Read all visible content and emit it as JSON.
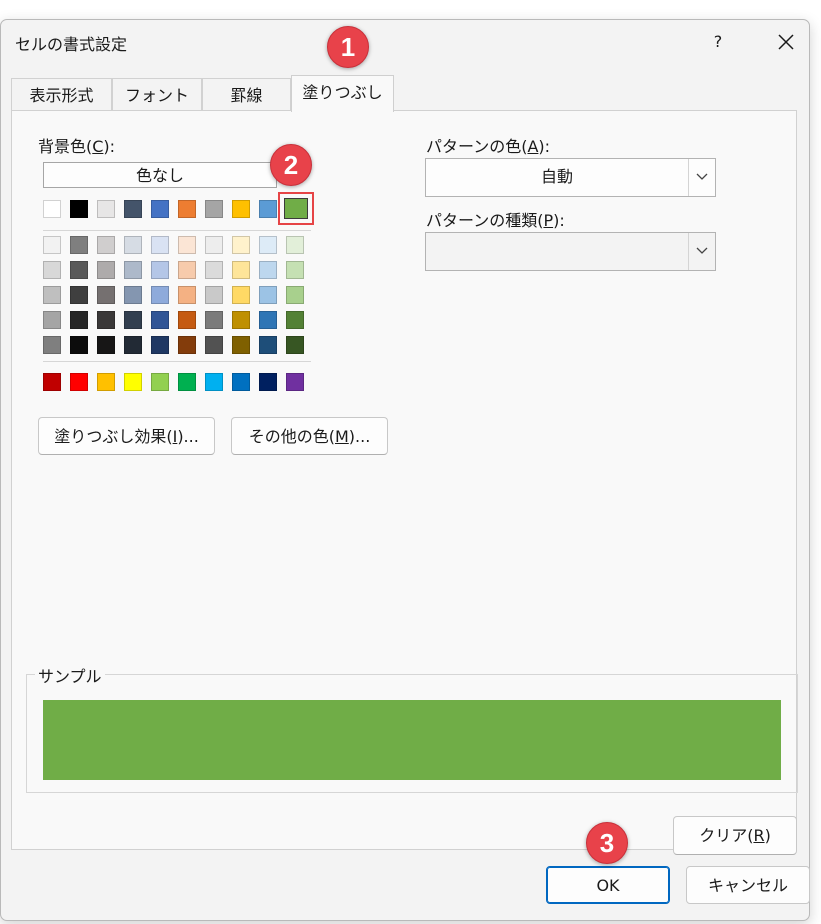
{
  "dialog": {
    "title": "セルの書式設定",
    "help_label": "?",
    "close_label": "✕"
  },
  "tabs": [
    {
      "label": "表示形式",
      "active": false
    },
    {
      "label": "フォント",
      "active": false
    },
    {
      "label": "罫線",
      "active": false
    },
    {
      "label": "塗りつぶし",
      "active": true
    }
  ],
  "fill": {
    "background_label_pre": "背景色(",
    "background_label_key": "C",
    "background_label_post": "):",
    "no_color_label": "色なし",
    "theme_row": [
      "#ffffff",
      "#000000",
      "#e7e6e6",
      "#44546a",
      "#4472c4",
      "#ed7d31",
      "#a5a5a5",
      "#ffc000",
      "#5b9bd5",
      "#70ad47"
    ],
    "tint_rows": [
      [
        "#f2f2f2",
        "#7f7f7f",
        "#d0cece",
        "#d6dce4",
        "#d9e2f3",
        "#fbe5d5",
        "#ededed",
        "#fff2cc",
        "#ddebf7",
        "#e2efd9"
      ],
      [
        "#d8d8d8",
        "#595959",
        "#aeabab",
        "#adb9ca",
        "#b4c6e7",
        "#f7cbac",
        "#dbdbdb",
        "#fee599",
        "#bdd7ee",
        "#c5e0b3"
      ],
      [
        "#bfbfbf",
        "#3f3f3f",
        "#757070",
        "#8496b0",
        "#8eaadb",
        "#f4b183",
        "#c9c9c9",
        "#ffd965",
        "#9cc3e5",
        "#a8d08d"
      ],
      [
        "#a5a5a5",
        "#262626",
        "#3a3838",
        "#323f4f",
        "#2f5496",
        "#c55a11",
        "#7b7b7b",
        "#bf9000",
        "#2e75b5",
        "#538135"
      ],
      [
        "#7f7f7f",
        "#0c0c0c",
        "#171616",
        "#222a35",
        "#1f3864",
        "#833c0b",
        "#525252",
        "#7f6000",
        "#1e4e79",
        "#375623"
      ]
    ],
    "standard_row": [
      "#c00000",
      "#ff0000",
      "#ffc000",
      "#ffff00",
      "#92d050",
      "#00b050",
      "#00b0f0",
      "#0070c0",
      "#002060",
      "#7030a0"
    ],
    "selected_color": "#70ad47",
    "fill_effects_pre": "塗りつぶし効果(",
    "fill_effects_key": "I",
    "fill_effects_post": ")...",
    "more_colors_pre": "その他の色(",
    "more_colors_key": "M",
    "more_colors_post": ")..."
  },
  "pattern": {
    "color_label_pre": "パターンの色(",
    "color_label_key": "A",
    "color_label_post": "):",
    "color_value": "自動",
    "style_label_pre": "パターンの種類(",
    "style_label_key": "P",
    "style_label_post": "):",
    "style_value": ""
  },
  "sample": {
    "label": "サンプル",
    "color": "#70ad47"
  },
  "buttons": {
    "clear_pre": "クリア(",
    "clear_key": "R",
    "clear_post": ")",
    "ok": "OK",
    "cancel": "キャンセル"
  },
  "annotations": {
    "step1": "1",
    "step2": "2",
    "step3": "3",
    "badge_color": "#e8424a",
    "highlight_color": "#e64446"
  }
}
